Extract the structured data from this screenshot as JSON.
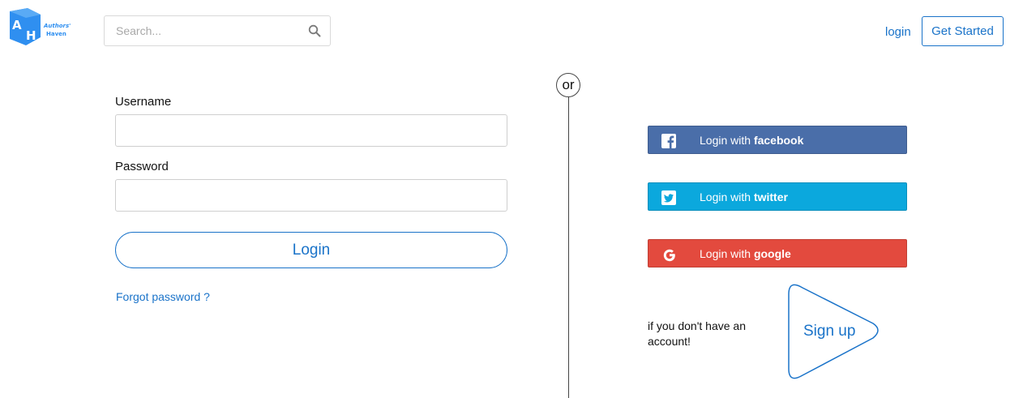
{
  "brand": {
    "logo_letters": [
      "A",
      "H"
    ],
    "logo_text": [
      "Authors'",
      "Haven"
    ]
  },
  "header": {
    "search": {
      "placeholder": "Search...",
      "value": "",
      "icon": "search-icon"
    },
    "login_link": "login",
    "get_started_button": "Get Started"
  },
  "login_form": {
    "username_label": "Username",
    "username_value": "",
    "password_label": "Password",
    "password_value": "",
    "submit_button": "Login",
    "forgot_link": "Forgot password ?"
  },
  "divider": {
    "label": "or"
  },
  "social": [
    {
      "prefix": "Login with ",
      "provider": "facebook",
      "icon": "facebook-icon",
      "color": "#4a6ea9"
    },
    {
      "prefix": "Login with ",
      "provider": "twitter",
      "icon": "twitter-icon",
      "color": "#0ba8dd"
    },
    {
      "prefix": "Login with ",
      "provider": "google",
      "icon": "google-icon",
      "color": "#e34a3e"
    }
  ],
  "signup": {
    "note": "if you don't have an account!",
    "button": "Sign up"
  },
  "colors": {
    "accent": "#1a73c9",
    "logo_blue": "#2f8ff0"
  }
}
